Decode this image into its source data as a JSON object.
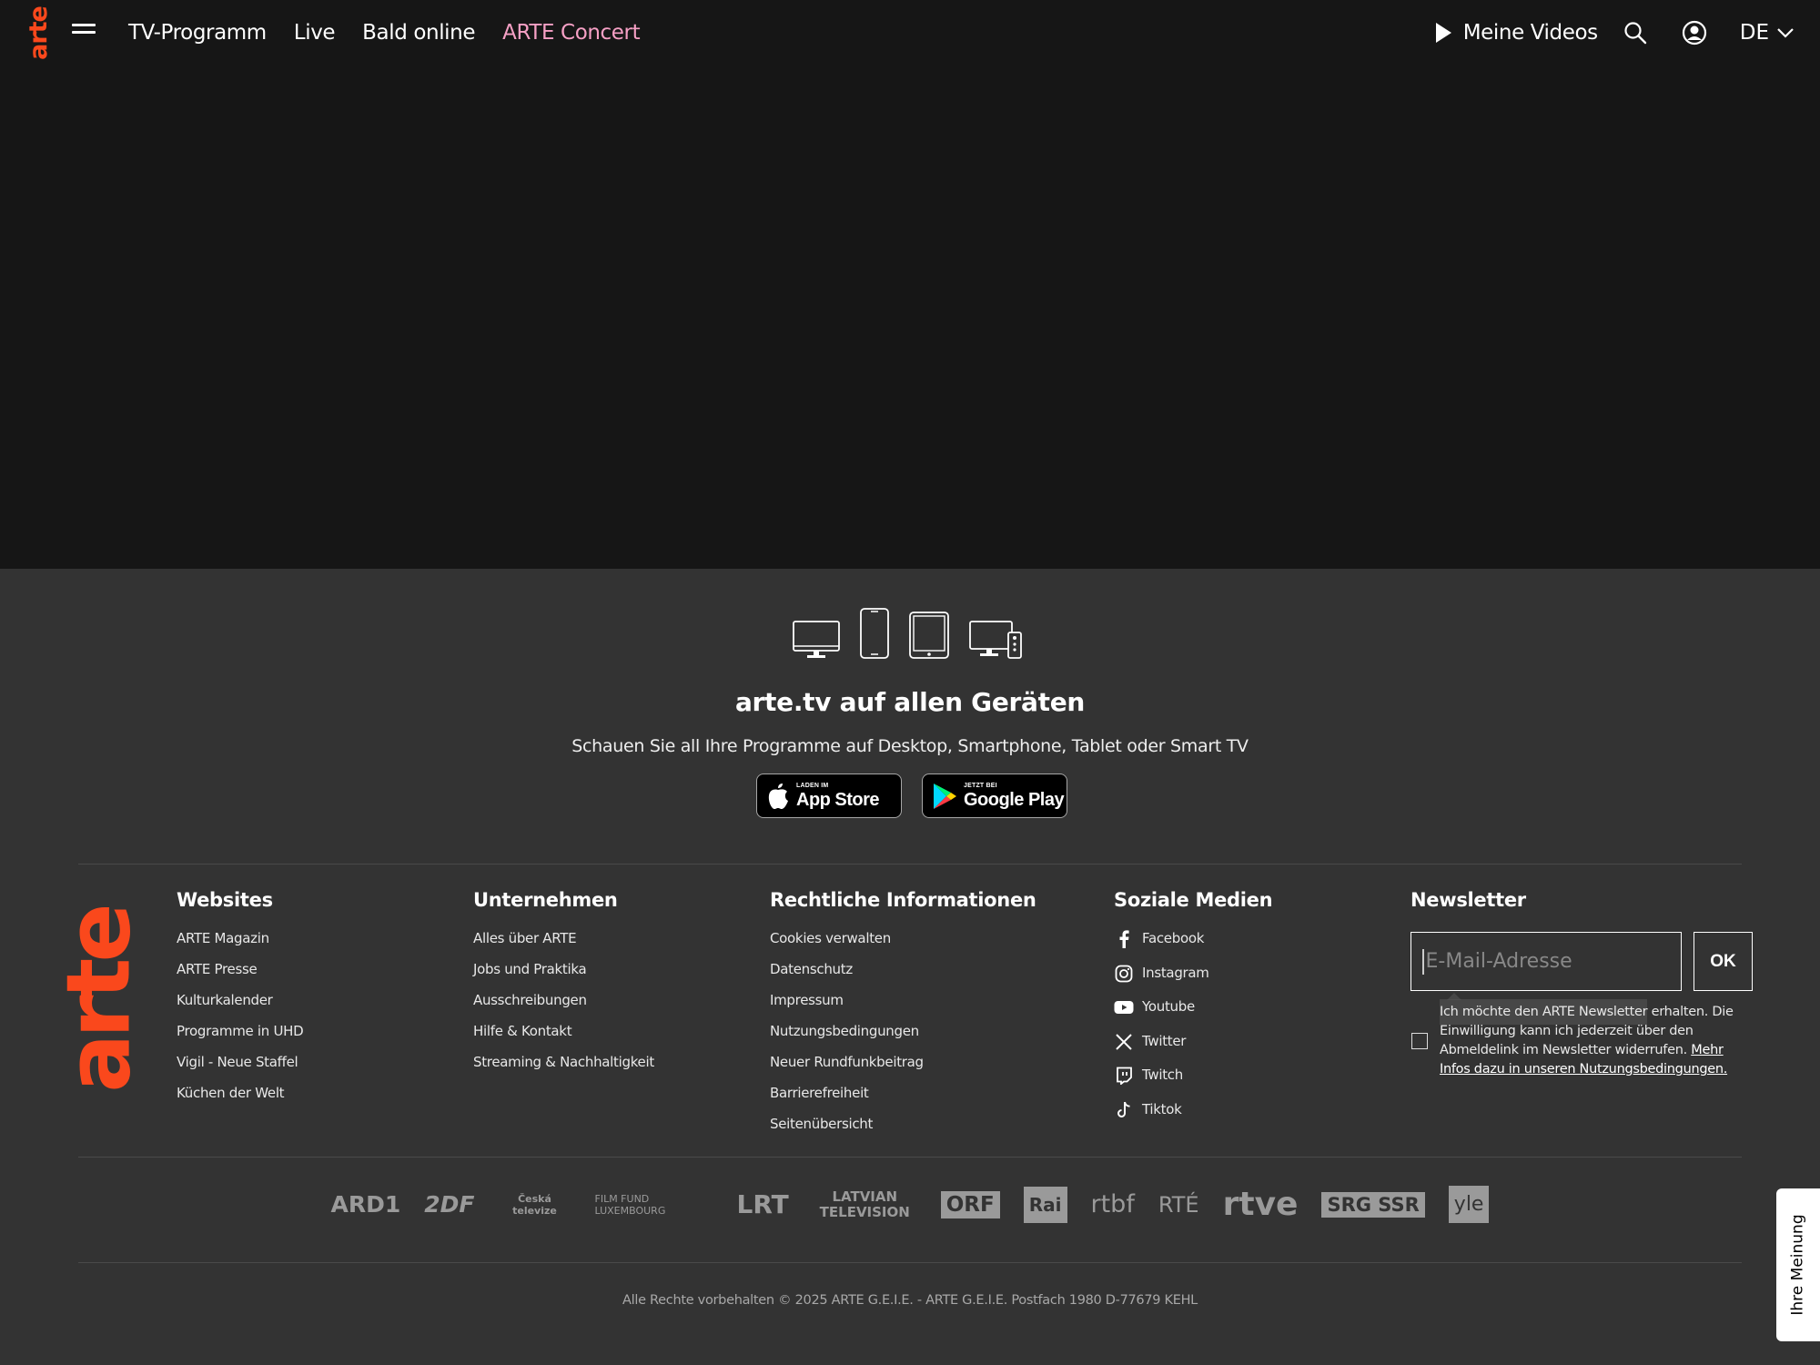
{
  "header": {
    "logo": "arte",
    "nav": [
      {
        "label": "TV-Programm"
      },
      {
        "label": "Live"
      },
      {
        "label": "Bald online"
      },
      {
        "label": "ARTE Concert"
      }
    ],
    "meine_videos": "Meine Videos",
    "language": "DE"
  },
  "footer": {
    "promo_title": "arte.tv auf allen Geräten",
    "promo_subtitle": "Schauen Sie all Ihre Programme auf Desktop, Smartphone, Tablet oder Smart TV",
    "app_store": {
      "small": "LADEN IM",
      "big": "App Store"
    },
    "google_play": {
      "small": "JETZT BEI",
      "big": "Google Play"
    },
    "logo": "arte",
    "columns": {
      "websites": {
        "title": "Websites",
        "items": [
          "ARTE Magazin",
          "ARTE Presse",
          "Kulturkalender",
          "Programme in UHD",
          "Vigil - Neue Staffel",
          "Küchen der Welt"
        ]
      },
      "unternehmen": {
        "title": "Unternehmen",
        "items": [
          "Alles über ARTE",
          "Jobs und Praktika",
          "Ausschreibungen",
          "Hilfe & Kontakt",
          "Streaming & Nachhaltigkeit"
        ]
      },
      "rechtliches": {
        "title": "Rechtliche Informationen",
        "items": [
          "Cookies verwalten",
          "Datenschutz",
          "Impressum",
          "Nutzungsbedingungen",
          "Neuer Rundfunkbeitrag",
          "Barrierefreiheit",
          "Seitenübersicht"
        ]
      },
      "social": {
        "title": "Soziale Medien",
        "items": [
          {
            "label": "Facebook",
            "icon": "facebook-icon"
          },
          {
            "label": "Instagram",
            "icon": "instagram-icon"
          },
          {
            "label": "Youtube",
            "icon": "youtube-icon"
          },
          {
            "label": "Twitter",
            "icon": "x-twitter-icon"
          },
          {
            "label": "Twitch",
            "icon": "twitch-icon"
          },
          {
            "label": "Tiktok",
            "icon": "tiktok-icon"
          }
        ]
      }
    },
    "newsletter": {
      "title": "Newsletter",
      "placeholder": "E-Mail-Adresse",
      "ok": "OK",
      "consent_text": "Ich möchte den ARTE Newsletter erhalten. Die Einwilligung kann ich jederzeit über den Abmeldelink im Newsletter widerrufen. ",
      "consent_link": "Mehr Infos dazu in unseren Nutzungsbedingungen."
    },
    "partners": [
      "ARD1",
      "2DF",
      "Česká televize",
      "FILM FUND LUXEMBOURG",
      "LRT",
      "LATVIAN TELEVISION",
      "ORF",
      "Rai",
      "rtbf",
      "RTÉ",
      "rtve",
      "SRG SSR",
      "yle"
    ],
    "copyright": "Alle Rechte vorbehalten © 2025 ARTE G.E.I.E. - ARTE G.E.I.E. Postfach 1980 D-77679 KEHL"
  },
  "feedback_tab": "Ihre Meinung",
  "colors": {
    "brand": "#fa481c",
    "accent_nav": "#f6a0c5",
    "page_bg": "#161616",
    "footer_bg": "#333333"
  }
}
